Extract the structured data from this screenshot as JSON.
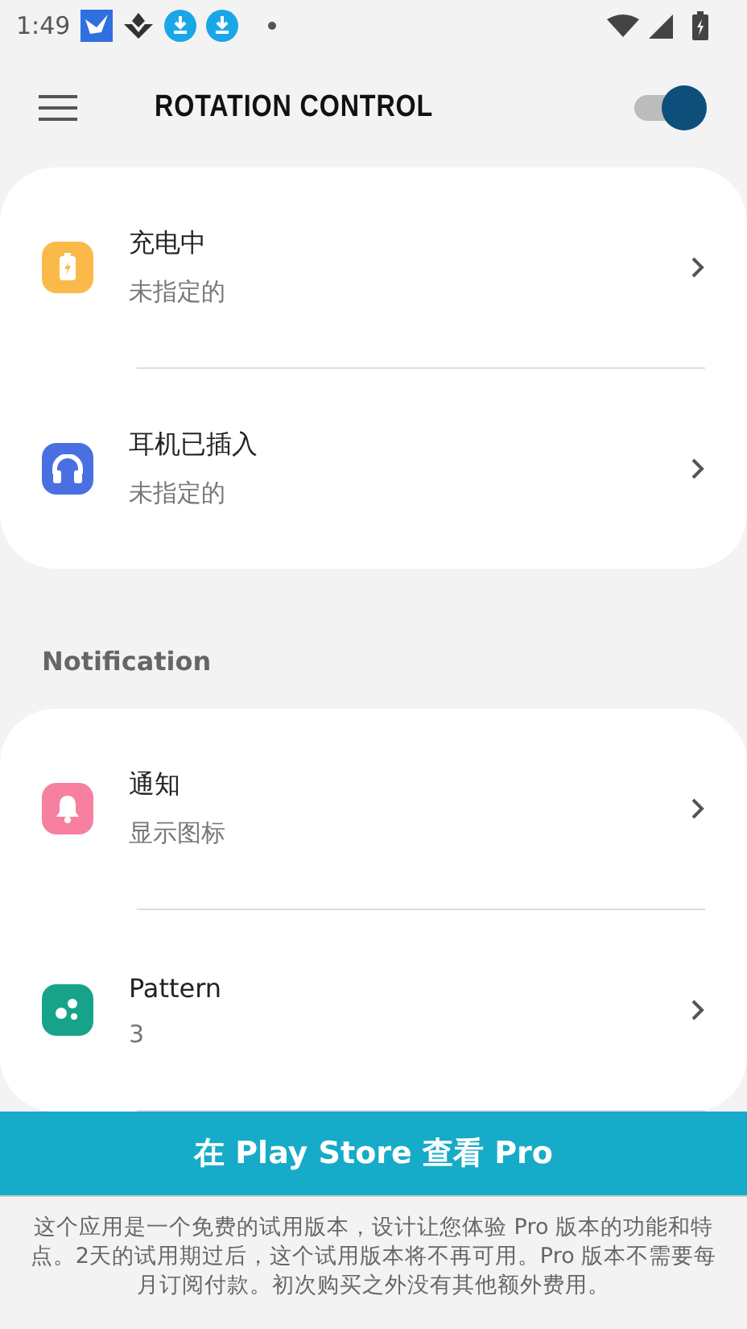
{
  "status_bar": {
    "time": "1:49"
  },
  "app_bar": {
    "title": "ROTATION CONTROL",
    "switch_on": true
  },
  "sections": [
    {
      "items": [
        {
          "title": "充电中",
          "subtitle": "未指定的",
          "color": "#fbb94a"
        },
        {
          "title": "耳机已插入",
          "subtitle": "未指定的",
          "color": "#4a6fe0"
        }
      ]
    },
    {
      "header": "Notification",
      "items": [
        {
          "title": "通知",
          "subtitle": "显示图标",
          "color": "#f77fa0"
        },
        {
          "title": "Pattern",
          "subtitle": "3",
          "color": "#17a38a"
        }
      ]
    }
  ],
  "banner": {
    "button": "在 Play Store 查看 Pro",
    "note": "这个应用是一个免费的试用版本，设计让您体验 Pro 版本的功能和特点。2天的试用期过后，这个试用版本将不再可用。Pro 版本不需要每月订阅付款。初次购买之外没有其他额外费用。"
  }
}
